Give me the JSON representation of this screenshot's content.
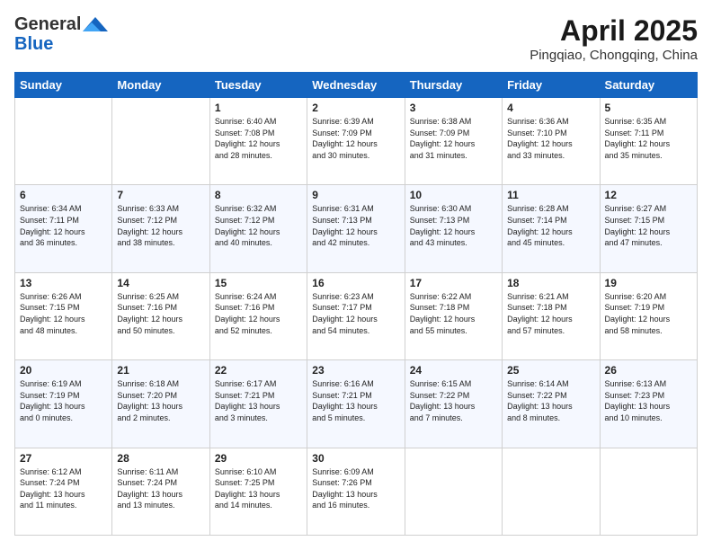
{
  "header": {
    "logo_general": "General",
    "logo_blue": "Blue",
    "month_year": "April 2025",
    "location": "Pingqiao, Chongqing, China"
  },
  "weekdays": [
    "Sunday",
    "Monday",
    "Tuesday",
    "Wednesday",
    "Thursday",
    "Friday",
    "Saturday"
  ],
  "weeks": [
    [
      {
        "day": "",
        "info": ""
      },
      {
        "day": "",
        "info": ""
      },
      {
        "day": "1",
        "info": "Sunrise: 6:40 AM\nSunset: 7:08 PM\nDaylight: 12 hours\nand 28 minutes."
      },
      {
        "day": "2",
        "info": "Sunrise: 6:39 AM\nSunset: 7:09 PM\nDaylight: 12 hours\nand 30 minutes."
      },
      {
        "day": "3",
        "info": "Sunrise: 6:38 AM\nSunset: 7:09 PM\nDaylight: 12 hours\nand 31 minutes."
      },
      {
        "day": "4",
        "info": "Sunrise: 6:36 AM\nSunset: 7:10 PM\nDaylight: 12 hours\nand 33 minutes."
      },
      {
        "day": "5",
        "info": "Sunrise: 6:35 AM\nSunset: 7:11 PM\nDaylight: 12 hours\nand 35 minutes."
      }
    ],
    [
      {
        "day": "6",
        "info": "Sunrise: 6:34 AM\nSunset: 7:11 PM\nDaylight: 12 hours\nand 36 minutes."
      },
      {
        "day": "7",
        "info": "Sunrise: 6:33 AM\nSunset: 7:12 PM\nDaylight: 12 hours\nand 38 minutes."
      },
      {
        "day": "8",
        "info": "Sunrise: 6:32 AM\nSunset: 7:12 PM\nDaylight: 12 hours\nand 40 minutes."
      },
      {
        "day": "9",
        "info": "Sunrise: 6:31 AM\nSunset: 7:13 PM\nDaylight: 12 hours\nand 42 minutes."
      },
      {
        "day": "10",
        "info": "Sunrise: 6:30 AM\nSunset: 7:13 PM\nDaylight: 12 hours\nand 43 minutes."
      },
      {
        "day": "11",
        "info": "Sunrise: 6:28 AM\nSunset: 7:14 PM\nDaylight: 12 hours\nand 45 minutes."
      },
      {
        "day": "12",
        "info": "Sunrise: 6:27 AM\nSunset: 7:15 PM\nDaylight: 12 hours\nand 47 minutes."
      }
    ],
    [
      {
        "day": "13",
        "info": "Sunrise: 6:26 AM\nSunset: 7:15 PM\nDaylight: 12 hours\nand 48 minutes."
      },
      {
        "day": "14",
        "info": "Sunrise: 6:25 AM\nSunset: 7:16 PM\nDaylight: 12 hours\nand 50 minutes."
      },
      {
        "day": "15",
        "info": "Sunrise: 6:24 AM\nSunset: 7:16 PM\nDaylight: 12 hours\nand 52 minutes."
      },
      {
        "day": "16",
        "info": "Sunrise: 6:23 AM\nSunset: 7:17 PM\nDaylight: 12 hours\nand 54 minutes."
      },
      {
        "day": "17",
        "info": "Sunrise: 6:22 AM\nSunset: 7:18 PM\nDaylight: 12 hours\nand 55 minutes."
      },
      {
        "day": "18",
        "info": "Sunrise: 6:21 AM\nSunset: 7:18 PM\nDaylight: 12 hours\nand 57 minutes."
      },
      {
        "day": "19",
        "info": "Sunrise: 6:20 AM\nSunset: 7:19 PM\nDaylight: 12 hours\nand 58 minutes."
      }
    ],
    [
      {
        "day": "20",
        "info": "Sunrise: 6:19 AM\nSunset: 7:19 PM\nDaylight: 13 hours\nand 0 minutes."
      },
      {
        "day": "21",
        "info": "Sunrise: 6:18 AM\nSunset: 7:20 PM\nDaylight: 13 hours\nand 2 minutes."
      },
      {
        "day": "22",
        "info": "Sunrise: 6:17 AM\nSunset: 7:21 PM\nDaylight: 13 hours\nand 3 minutes."
      },
      {
        "day": "23",
        "info": "Sunrise: 6:16 AM\nSunset: 7:21 PM\nDaylight: 13 hours\nand 5 minutes."
      },
      {
        "day": "24",
        "info": "Sunrise: 6:15 AM\nSunset: 7:22 PM\nDaylight: 13 hours\nand 7 minutes."
      },
      {
        "day": "25",
        "info": "Sunrise: 6:14 AM\nSunset: 7:22 PM\nDaylight: 13 hours\nand 8 minutes."
      },
      {
        "day": "26",
        "info": "Sunrise: 6:13 AM\nSunset: 7:23 PM\nDaylight: 13 hours\nand 10 minutes."
      }
    ],
    [
      {
        "day": "27",
        "info": "Sunrise: 6:12 AM\nSunset: 7:24 PM\nDaylight: 13 hours\nand 11 minutes."
      },
      {
        "day": "28",
        "info": "Sunrise: 6:11 AM\nSunset: 7:24 PM\nDaylight: 13 hours\nand 13 minutes."
      },
      {
        "day": "29",
        "info": "Sunrise: 6:10 AM\nSunset: 7:25 PM\nDaylight: 13 hours\nand 14 minutes."
      },
      {
        "day": "30",
        "info": "Sunrise: 6:09 AM\nSunset: 7:26 PM\nDaylight: 13 hours\nand 16 minutes."
      },
      {
        "day": "",
        "info": ""
      },
      {
        "day": "",
        "info": ""
      },
      {
        "day": "",
        "info": ""
      }
    ]
  ]
}
